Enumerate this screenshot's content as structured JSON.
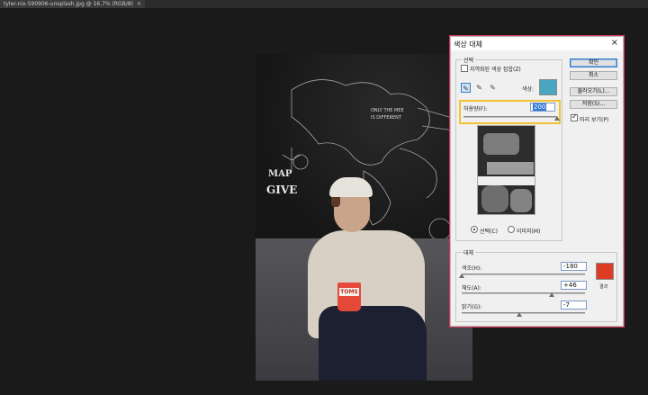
{
  "document_tab": {
    "title": "tyler-nix-590906-unsplash.jpg @ 16.7% (RGB/8)",
    "close_glyph": "×"
  },
  "canvas": {
    "chalk_texts": [
      "MAP",
      "GIVE",
      "ONLY THE MEE",
      "IS DIFFERENT"
    ],
    "cup_brand": "TOMS"
  },
  "dialog": {
    "title": "색상 대체",
    "close_glyph": "×",
    "selection": {
      "group_label": "선택",
      "localized_clusters_label": "지역화된 색상 집합(Z)",
      "localized_clusters_checked": false,
      "color_label": "색상:",
      "color_swatch": "#4aa6c0",
      "fuzziness_label": "허용량(F):",
      "fuzziness_value": "200",
      "fuzziness_fraction": 1.0,
      "selection_radio_label": "선택(C)",
      "image_radio_label": "이미지(M)",
      "selection_radio_checked": true
    },
    "replacement": {
      "group_label": "대체",
      "hue_label": "색조(H):",
      "hue_value": "-180",
      "saturation_label": "채도(A):",
      "saturation_value": "+46",
      "lightness_label": "밝기(G):",
      "lightness_value": "-7",
      "result_label": "결과",
      "result_swatch": "#dd3c22",
      "hue_fraction": 0.0,
      "saturation_fraction": 0.73,
      "lightness_fraction": 0.47
    },
    "buttons": {
      "ok": "확인",
      "cancel": "취소",
      "load": "불러오기(L)...",
      "save": "저장(S)...",
      "preview_label": "미리 보기(P)",
      "preview_checked": true
    }
  },
  "colors": {
    "highlight": "#f1c232",
    "dialog_border": "#d7335c",
    "selection_blue": "#3178d6"
  }
}
